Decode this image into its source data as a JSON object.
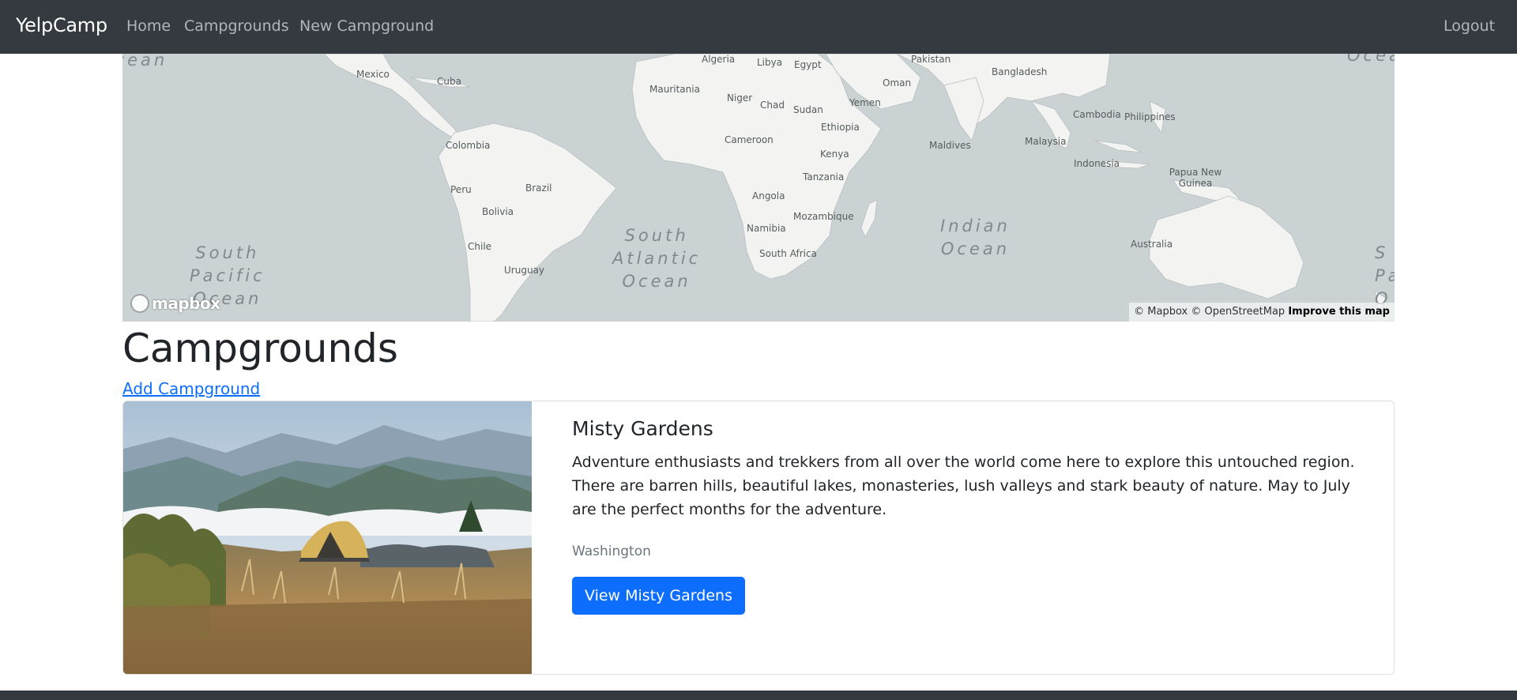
{
  "navbar": {
    "brand": "YelpCamp",
    "links": [
      {
        "label": "Home"
      },
      {
        "label": "Campgrounds"
      },
      {
        "label": "New Campground"
      }
    ],
    "logout": "Logout",
    "background_color": "#343a40"
  },
  "map": {
    "labels": {
      "algeria": "Algeria",
      "libya": "Libya",
      "egypt": "Egypt",
      "pakistan": "Pakistan",
      "mexico": "Mexico",
      "cuba": "Cuba",
      "mauritania": "Mauritania",
      "niger": "Niger",
      "chad": "Chad",
      "sudan": "Sudan",
      "oman": "Oman",
      "yemen": "Yemen",
      "bangladesh": "Bangladesh",
      "colombia": "Colombia",
      "cameroon": "Cameroon",
      "ethiopia": "Ethiopia",
      "kenya": "Kenya",
      "cambodia": "Cambodia",
      "philippines": "Philippines",
      "maldives": "Maldives",
      "malaysia": "Malaysia",
      "peru": "Peru",
      "brazil": "Brazil",
      "tanzania": "Tanzania",
      "indonesia": "Indonesia",
      "papua_new_guinea": "Papua New Guinea",
      "bolivia": "Bolivia",
      "angola": "Angola",
      "mozambique": "Mozambique",
      "namibia": "Namibia",
      "chile": "Chile",
      "south_africa": "South Africa",
      "uruguay": "Uruguay",
      "australia": "Australia"
    },
    "oceans": {
      "ocean_top_left": "Ocean",
      "ocean_top_right": "Ocean",
      "south_pacific": "South\nPacific\nOcean",
      "south_atlantic": "South\nAtlantic\nOcean",
      "indian": "Indian\nOcean",
      "sp_right": "S\nPa\nO"
    },
    "logo_text": "mapbox",
    "attribution": {
      "mapbox": "© Mapbox",
      "osm": "© OpenStreetMap",
      "improve": "Improve this map"
    },
    "water_color": "#cad2d3",
    "land_color": "#f3f3f1"
  },
  "main": {
    "title": "Campgrounds",
    "add_link": "Add Campground"
  },
  "campgrounds": [
    {
      "title": "Misty Gardens",
      "description": "Adventure enthusiasts and trekkers from all over the world come here to explore this untouched region. There are barren hills, beautiful lakes, monasteries, lush valleys and stark beauty of nature. May to July are the perfect months for the adventure.",
      "location": "Washington",
      "button_label": "View Misty Gardens",
      "button_color": "#0d6efd"
    }
  ]
}
